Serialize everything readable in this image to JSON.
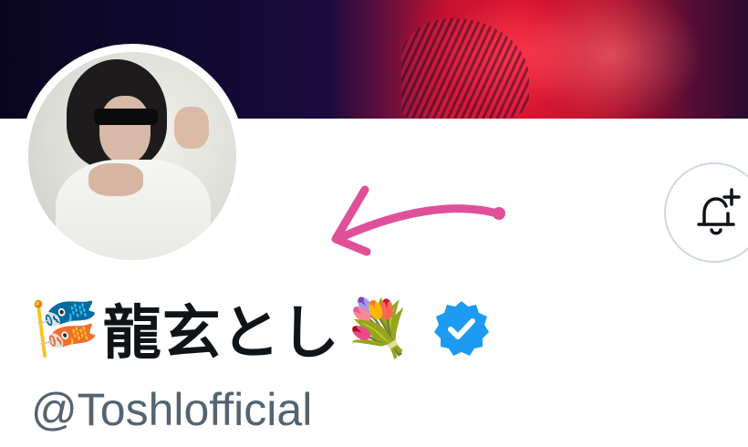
{
  "profile": {
    "display_name": "龍玄とし",
    "leading_emoji": "🎏",
    "trailing_emoji": "💐",
    "handle": "@Toshlofficial",
    "verified": true,
    "verified_color": "#1d9bf0"
  },
  "actions": {
    "notification_icon": "bell-plus-icon"
  },
  "annotation": {
    "arrow_color": "#e0509a",
    "arrow_icon": "hand-drawn-arrow"
  },
  "colors": {
    "text_primary": "#0f1419",
    "text_secondary": "#536471",
    "border": "#cfd9de"
  }
}
